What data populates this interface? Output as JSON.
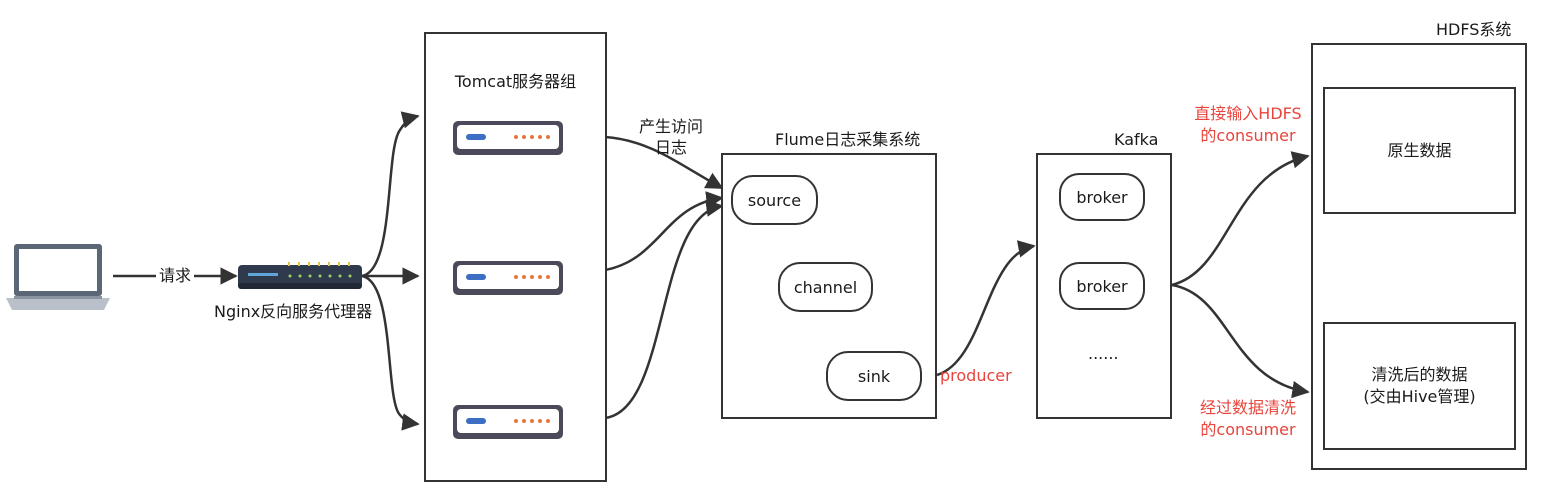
{
  "client": {
    "icon": "laptop-icon"
  },
  "edges": {
    "request": "请求",
    "generate_log_line1": "产生访问",
    "generate_log_line2": "日志",
    "producer": "producer",
    "direct_consumer_line1": "直接输入HDFS",
    "direct_consumer_line2": "的consumer",
    "clean_consumer_line1": "经过数据清洗",
    "clean_consumer_line2": "的consumer"
  },
  "nginx": {
    "label": "Nginx反向服务代理器",
    "icon": "router-icon"
  },
  "tomcat": {
    "title": "Tomcat服务器组",
    "icon": "server-icon"
  },
  "flume": {
    "title": "Flume日志采集系统",
    "source": "source",
    "channel": "channel",
    "sink": "sink"
  },
  "kafka": {
    "title": "Kafka",
    "broker1": "broker",
    "broker2": "broker",
    "more": "......"
  },
  "hdfs": {
    "title": "HDFS系统",
    "raw": "原生数据",
    "cleaned_line1": "清洗后的数据",
    "cleaned_line2": "(交由Hive管理)"
  },
  "colors": {
    "accent": "#e8453c",
    "stroke": "#333333",
    "server_body": "#4a4a5a",
    "led": "#e8763c",
    "nginx_body": "#2f3b4c"
  }
}
